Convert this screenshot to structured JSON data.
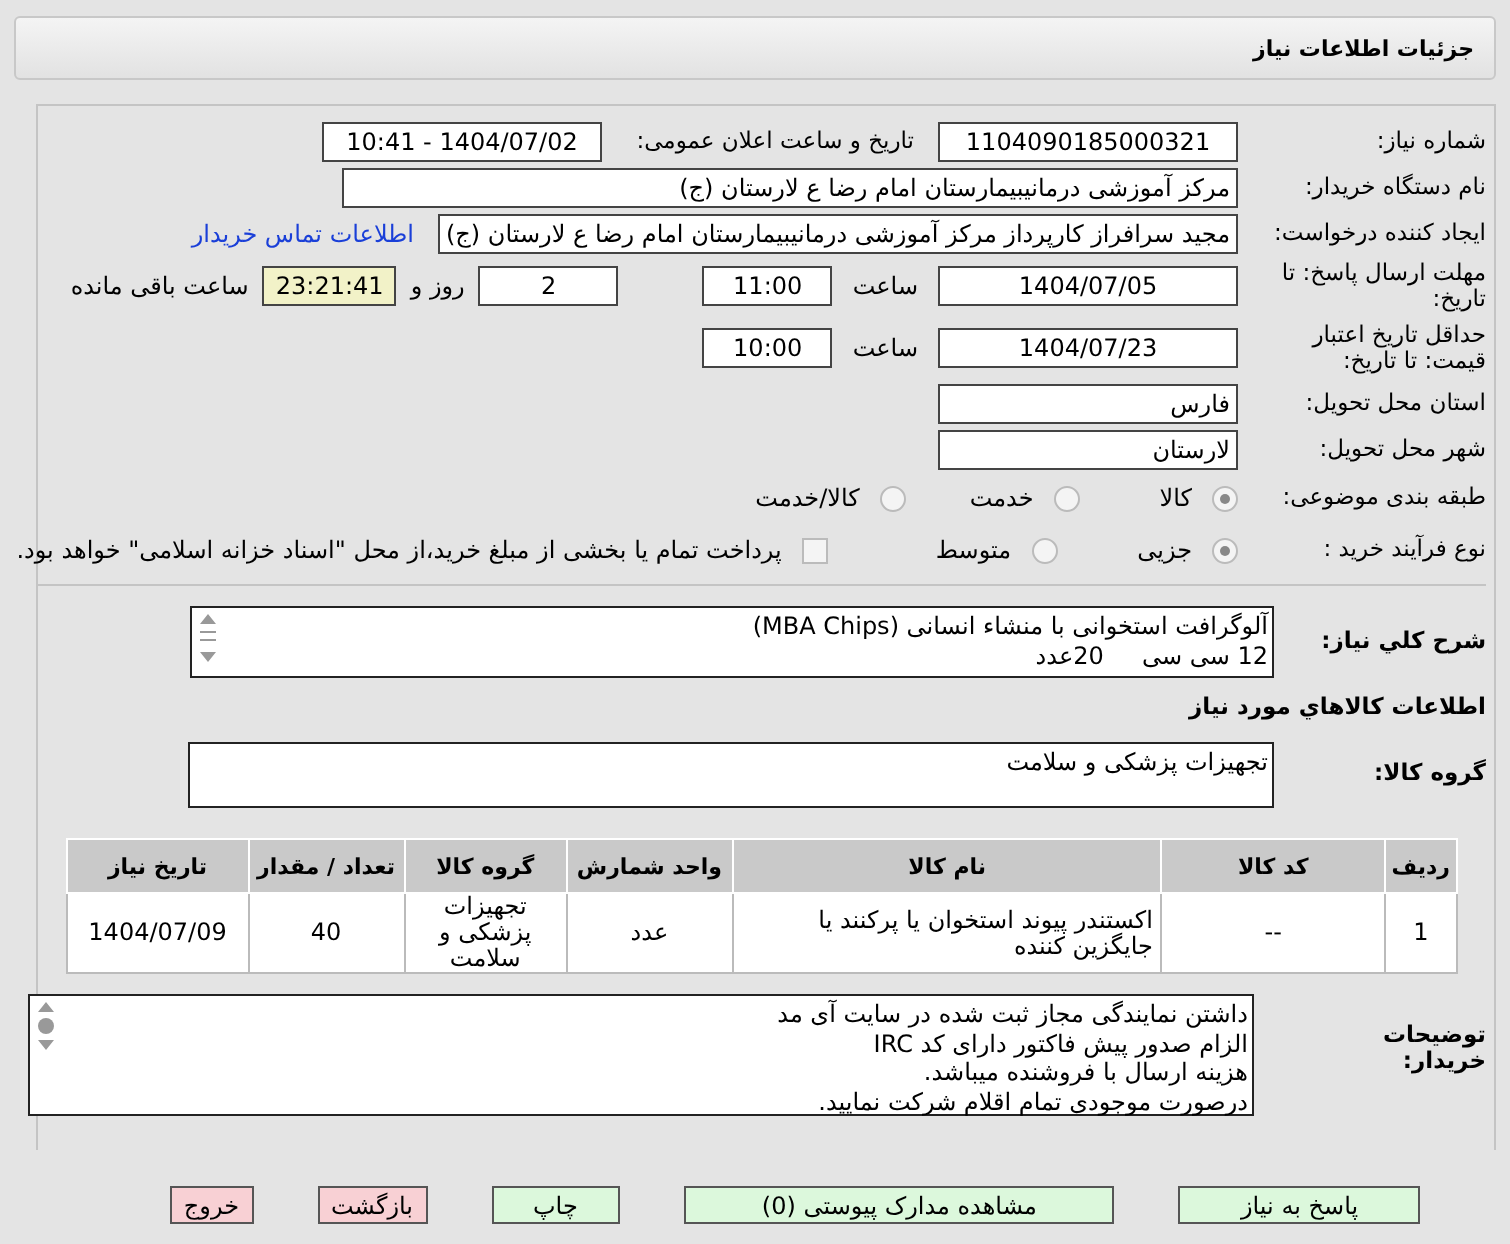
{
  "header": {
    "title": "جزئیات اطلاعات نیاز"
  },
  "need_number": {
    "label": "شماره نیاز:",
    "value": "1104090185000321"
  },
  "announce": {
    "label": "تاریخ و ساعت اعلان عمومی:",
    "value": "1404/07/02 - 10:41"
  },
  "buyer": {
    "label": "نام دستگاه خریدار:",
    "value": "مرکز آموزشی درمانیبیمارستان امام رضا  ع  لارستان (ج)"
  },
  "requester": {
    "label": "ایجاد کننده درخواست:",
    "value": "مجید سرافراز کارپرداز  مرکز آموزشی درمانیبیمارستان امام رضا  ع  لارستان (ج)",
    "link": "اطلاعات تماس خریدار"
  },
  "deadline": {
    "label": "مهلت ارسال پاسخ: تا تاریخ:",
    "date": "1404/07/05",
    "time_label": "ساعت",
    "time": "11:00",
    "days": "2",
    "days_label": "روز و",
    "remaining": "23:21:41",
    "remaining_label": "ساعت باقی مانده"
  },
  "validity": {
    "label": "حداقل تاریخ اعتبار قیمت: تا تاریخ:",
    "date": "1404/07/23",
    "time_label": "ساعت",
    "time": "10:00"
  },
  "province": {
    "label": "استان محل تحویل:",
    "value": "فارس"
  },
  "city": {
    "label": "شهر محل تحویل:",
    "value": "لارستان"
  },
  "category": {
    "label": "طبقه بندی موضوعی:",
    "options": [
      {
        "label": "کالا",
        "selected": true
      },
      {
        "label": "خدمت",
        "selected": false
      },
      {
        "label": "کالا/خدمت",
        "selected": false
      }
    ]
  },
  "process": {
    "label": "نوع فرآیند خرید :",
    "options": [
      {
        "label": "جزیی",
        "selected": true
      },
      {
        "label": "متوسط",
        "selected": false
      }
    ],
    "treasury": {
      "checked": false,
      "label": "پرداخت تمام یا بخشی از مبلغ خرید،از محل \"اسناد خزانه اسلامی\" خواهد بود."
    }
  },
  "description": {
    "label": "شرح کلي نياز:",
    "lines": [
      "آلوگرافت استخوانی با منشاء انسانی (MBA Chips)",
      "12 سی سی     20عدد"
    ]
  },
  "goods_title": "اطلاعات کالاهاي مورد نياز",
  "goods_group": {
    "label": "گروه کالا:",
    "value": "تجهیزات پزشکی و سلامت"
  },
  "table": {
    "columns": [
      "ردیف",
      "کد کالا",
      "نام کالا",
      "واحد شمارش",
      "گروه کالا",
      "تعداد / مقدار",
      "تاریخ نیاز"
    ],
    "rows": [
      [
        "1",
        "--",
        "اکستندر پیوند استخوان یا پرکنند یا جایگزین کننده",
        "عدد",
        "تجهیزات پزشکی و سلامت",
        "40",
        "1404/07/09"
      ]
    ]
  },
  "notes": {
    "label": "توضیحات خریدار:",
    "lines": [
      "داشتن نمایندگی مجاز ثبت شده در سایت آی مد",
      "الزام صدور پیش فاکتور دارای کد IRC",
      "هزینه ارسال با فروشنده میباشد.",
      "درصورت موجودی تمام اقلام شرکت نمایید."
    ]
  },
  "buttons": [
    {
      "label": "پاسخ به نیاز",
      "kind": "go"
    },
    {
      "label": "مشاهده مدارک پیوستی (0)",
      "kind": "go"
    },
    {
      "label": "چاپ",
      "kind": "go"
    },
    {
      "label": "بازگشت",
      "kind": "stop"
    },
    {
      "label": "خروج",
      "kind": "stop"
    }
  ]
}
